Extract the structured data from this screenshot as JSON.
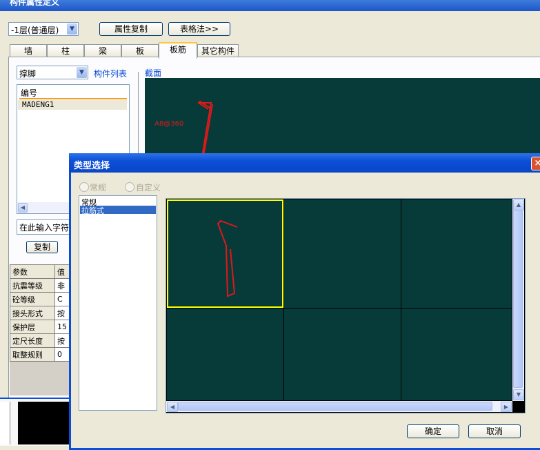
{
  "window": {
    "title": "构件属性定义"
  },
  "toolbar": {
    "floor_select": "-1层(普通层)",
    "copy_props_btn": "属性复制",
    "table_method_btn": "表格法>>"
  },
  "tabs": [
    "墙",
    "柱",
    "梁",
    "板",
    "板筋",
    "其它构件"
  ],
  "left": {
    "type_select": "撑脚",
    "component_list_label": "构件列表",
    "list_header": "编号",
    "list_items": [
      "MADENG1"
    ],
    "filter_input": "在此输入字符",
    "copy_btn": "复制"
  },
  "section": {
    "label": "截面",
    "rebar_label": "A8@360"
  },
  "params": {
    "header": [
      "参数",
      "值"
    ],
    "rows": [
      {
        "name": "抗震等级",
        "value": "非"
      },
      {
        "name": "砼等级",
        "value": "C"
      },
      {
        "name": "接头形式",
        "value": "按"
      },
      {
        "name": "保护层",
        "value": "15"
      },
      {
        "name": "定尺长度",
        "value": "按"
      },
      {
        "name": "取整规则",
        "value": "0"
      }
    ]
  },
  "dialog": {
    "title": "类型选择",
    "close": "×",
    "radio_normal": "常规",
    "radio_custom": "自定义",
    "type_list": [
      "常规",
      "拉筋式"
    ],
    "selected_type": "拉筋式",
    "ok_btn": "确定",
    "cancel_btn": "取消"
  },
  "colors": {
    "canvas": "#073b3a",
    "rebar": "#e01818",
    "selection": "#ffff00",
    "highlight": "#316ac5"
  }
}
